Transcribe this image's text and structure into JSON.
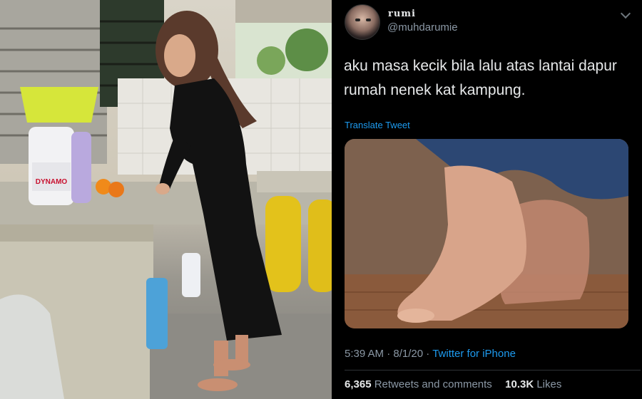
{
  "photo": {
    "detergent_label": "DYNAMO"
  },
  "tweet": {
    "display_name": "rumi",
    "handle": "@muhdarumie",
    "text_line1": "aku masa kecik bila lalu atas lantai dapur",
    "text_line2": "rumah nenek kat kampung.",
    "translate_label": "Translate Tweet",
    "time": "5:39 AM",
    "separator": "·",
    "date": "8/1/20",
    "source": "Twitter for iPhone",
    "retweets_count": "6,365",
    "retweets_label": "Retweets and comments",
    "likes_count": "10.3K",
    "likes_label": "Likes",
    "icons": {
      "more": "chevron-down-icon"
    },
    "colors": {
      "link": "#1d9bf0",
      "background": "#000000",
      "text": "#e7e9ea",
      "muted": "#8b98a5"
    }
  }
}
